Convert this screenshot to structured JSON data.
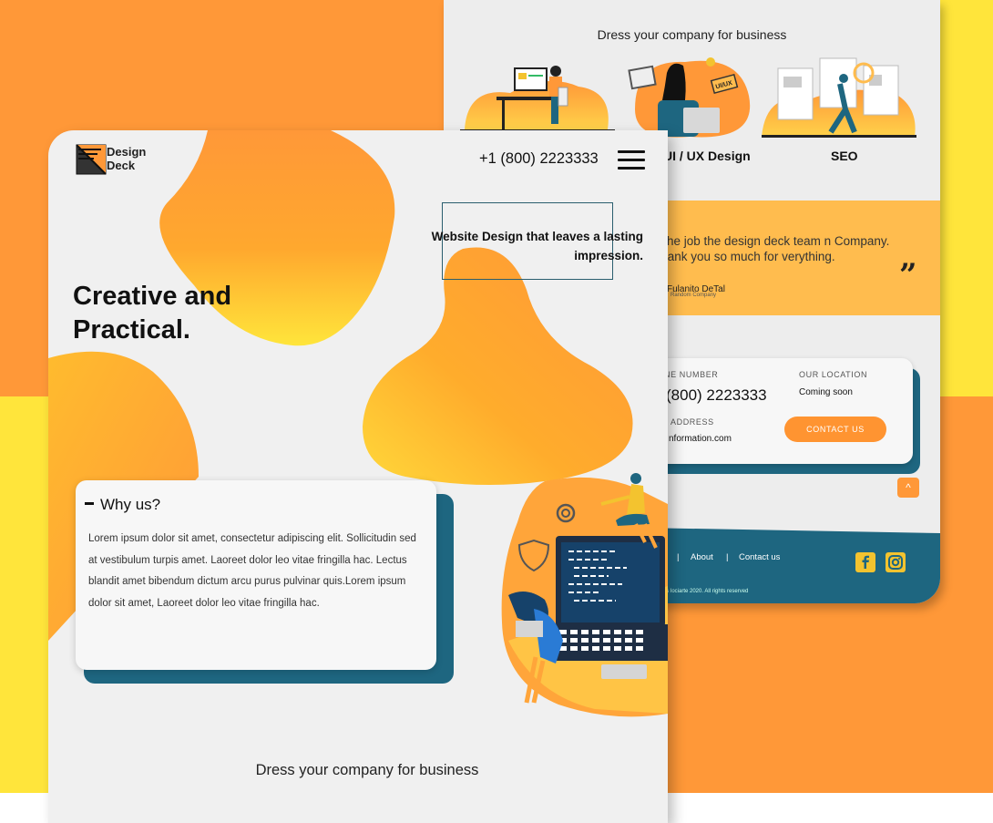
{
  "colors": {
    "orange": "#FF9838",
    "yellow": "#FFE53B",
    "teal": "#1E6680",
    "card": "#F0F0F0"
  },
  "back": {
    "section_title": "Dress your company for business",
    "services": [
      {
        "label": ""
      },
      {
        "label": "UI / UX Design"
      },
      {
        "label": "SEO"
      }
    ],
    "testimonial": {
      "text": "h the job the design deck team n Company. Thank you so much for verything.",
      "name": "Fulanito DeTal",
      "company": "Random Company"
    },
    "contact": {
      "phone_label": "NE NUMBER",
      "phone_value": "(800) 2223333",
      "location_label": "OUR LOCATION",
      "location_value": "Coming soon",
      "email_label": "ADDRESS",
      "email_value": "nformation.com",
      "button": "CONTACT US"
    },
    "footer": {
      "links": [
        "About",
        "Contact us"
      ],
      "copyright": "s Iociarte 2020. All rights reserved"
    }
  },
  "front": {
    "logo_line1": "Design",
    "logo_line2": "Deck",
    "phone": "+1 (800) 2223333",
    "tagline": "Website Design that leaves a lasting impression.",
    "hero_line1": "Creative and",
    "hero_line2": "Practical.",
    "why_title": "Why us?",
    "why_body": "Lorem ipsum dolor sit amet, consectetur adipiscing elit. Sollicitudin sed at vestibulum turpis amet. Laoreet dolor leo vitae fringilla hac. Lectus blandit amet bibendum dictum arcu purus pulvinar quis.Lorem ipsum dolor sit amet, Laoreet dolor leo vitae fringilla hac.",
    "bottom_title": "Dress your company for business"
  }
}
